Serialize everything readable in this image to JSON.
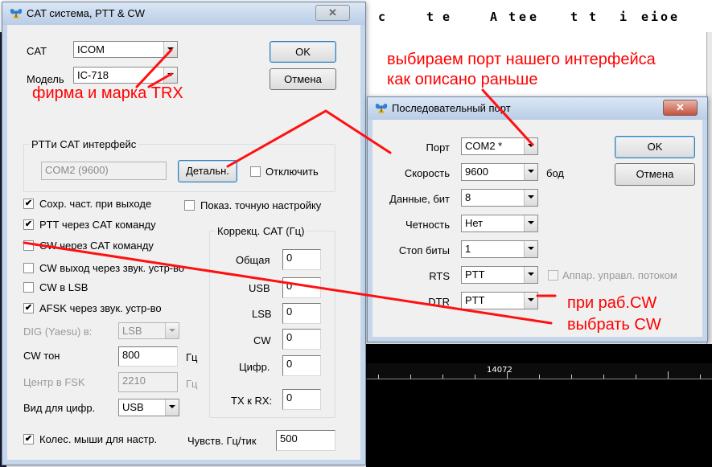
{
  "background": {
    "top_chars": [
      "c",
      "t",
      "e",
      "A",
      "t",
      "e",
      "e",
      "t",
      "t",
      "i",
      "e",
      "i",
      "o",
      "e"
    ],
    "frequency_label": "14072"
  },
  "cat_dialog": {
    "title": "CAT система, PTT & CW",
    "close_glyph": "✕",
    "cat_label": "CAT",
    "cat_value": "ICOM",
    "model_label": "Модель",
    "model_value": "IC-718",
    "ok_label": "OK",
    "cancel_label": "Отмена",
    "interface_group_title": "PTTи CAT интерфейс",
    "interface_value": "COM2 (9600)",
    "details_label": "Детальн.",
    "disable_label": "Отключить",
    "options": [
      {
        "label": "Сохр. част. при выходе",
        "checked": true
      },
      {
        "label": "PTT через CAT команду",
        "checked": true
      },
      {
        "label": "CW через CAT команду",
        "checked": false
      },
      {
        "label": "CW выход через звук. устр-во",
        "checked": false
      },
      {
        "label": "CW в LSB",
        "checked": false
      },
      {
        "label": "AFSK через звук. устр-во",
        "checked": true
      }
    ],
    "show_exact_label": "Показ. точную настройку",
    "dig_label": "DIG (Yaesu) в:",
    "dig_value": "LSB",
    "cw_tone_label": "CW тон",
    "cw_tone_value": "800",
    "cw_tone_unit": "Гц",
    "fsk_center_label": "Центр в FSK",
    "fsk_center_value": "2210",
    "fsk_center_unit": "Гц",
    "digital_mode_label": "Вид для цифр.",
    "digital_mode_value": "USB",
    "correction_group_title": "Коррекц. CAT (Гц)",
    "corrections": [
      {
        "label": "Общая",
        "value": "0"
      },
      {
        "label": "USB",
        "value": "0"
      },
      {
        "label": "LSB",
        "value": "0"
      },
      {
        "label": "CW",
        "value": "0"
      },
      {
        "label": "Цифр.",
        "value": "0"
      },
      {
        "label": "TX к RX:",
        "value": "0"
      }
    ],
    "wheel_label": "Колес. мыши для настр.",
    "wheel_checked": true,
    "sensitivity_label": "Чувств. Гц/тик",
    "sensitivity_value": "500"
  },
  "port_dialog": {
    "title": "Последовательный порт",
    "close_glyph": "✕",
    "ok_label": "OK",
    "cancel_label": "Отмена",
    "fields": [
      {
        "label": "Порт",
        "value": "COM2 *"
      },
      {
        "label": "Скорость",
        "value": "9600"
      },
      {
        "label": "Данные, бит",
        "value": "8"
      },
      {
        "label": "Четность",
        "value": "Нет"
      },
      {
        "label": "Стоп биты",
        "value": "1"
      },
      {
        "label": "RTS",
        "value": "PTT"
      },
      {
        "label": "DTR",
        "value": "PTT"
      }
    ],
    "speed_unit": "бод",
    "hw_flow_label": "Аппар. управл. потоком"
  },
  "annotations": {
    "brand_model": "фирма и марка TRX",
    "port_line1": "выбираем порт нашего интерфейса",
    "port_line2": "как описано раньше",
    "cw_line1": "при раб.CW",
    "cw_line2": "выбрать CW"
  },
  "colors": {
    "annotation": "#ff0000",
    "dialog_bg": "#f0f0f0",
    "title_gradient_top": "#dbe7f5",
    "close_active": "#c4513d"
  }
}
